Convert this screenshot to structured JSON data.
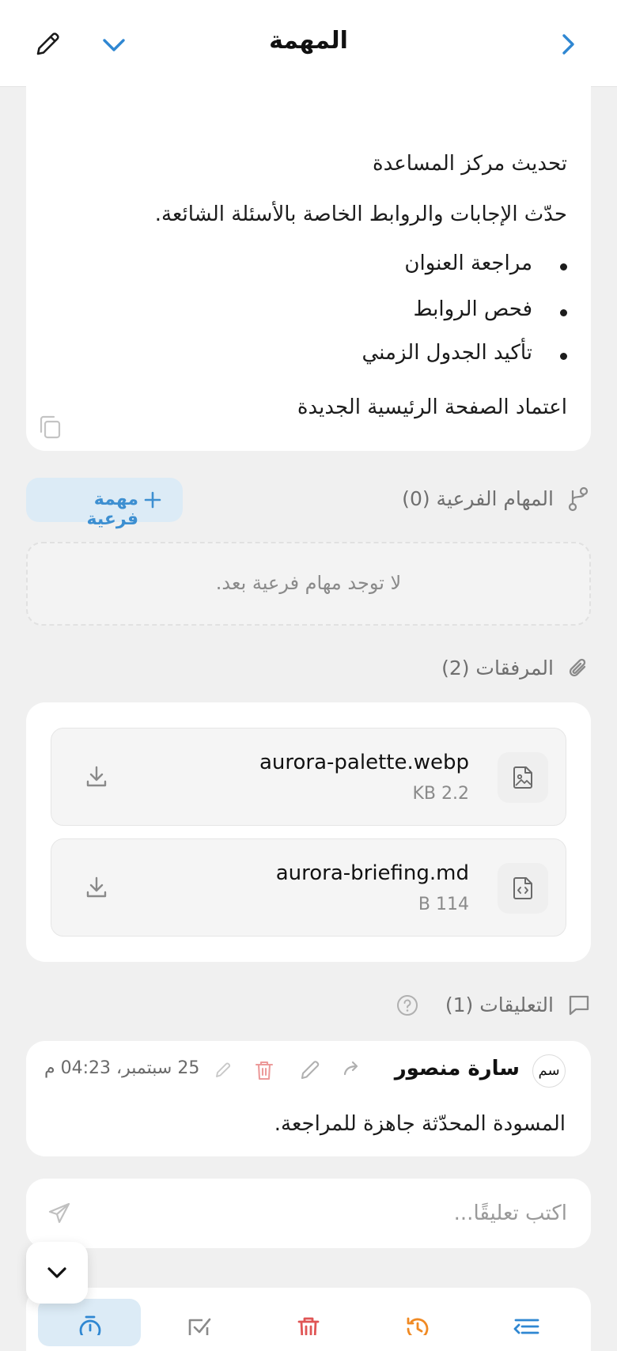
{
  "header": {
    "title": "المهمة"
  },
  "description": {
    "heading": "تحديث مركز المساعدة",
    "body": "حدّث الإجابات والروابط الخاصة بالأسئلة الشائعة.",
    "bullets": [
      "مراجعة العنوان",
      "فحص الروابط",
      "تأكيد الجدول الزمني"
    ],
    "footer": "اعتماد الصفحة الرئيسية الجديدة"
  },
  "subtasks": {
    "label": "المهام الفرعية (0)",
    "add_button": "مهمة فرعية",
    "empty_text": "لا توجد مهام فرعية بعد."
  },
  "attachments": {
    "label": "المرفقات (2)",
    "files": [
      {
        "name": "aurora-palette.webp",
        "size": "2.2 KB",
        "icon": "image-file-icon"
      },
      {
        "name": "aurora-briefing.md",
        "size": "114 B",
        "icon": "code-file-icon"
      }
    ]
  },
  "comments": {
    "label": "التعليقات (1)",
    "items": [
      {
        "avatar": "سم",
        "author": "سارة منصور",
        "time": "25 سبتمبر، 04:23 م",
        "text": "المسودة المحدّثة جاهزة للمراجعة."
      }
    ],
    "input_placeholder": "اكتب تعليقًا..."
  },
  "colors": {
    "accent": "#2f87d2",
    "danger": "#e05555",
    "warning": "#f08a24",
    "background": "#f0f0f0"
  }
}
